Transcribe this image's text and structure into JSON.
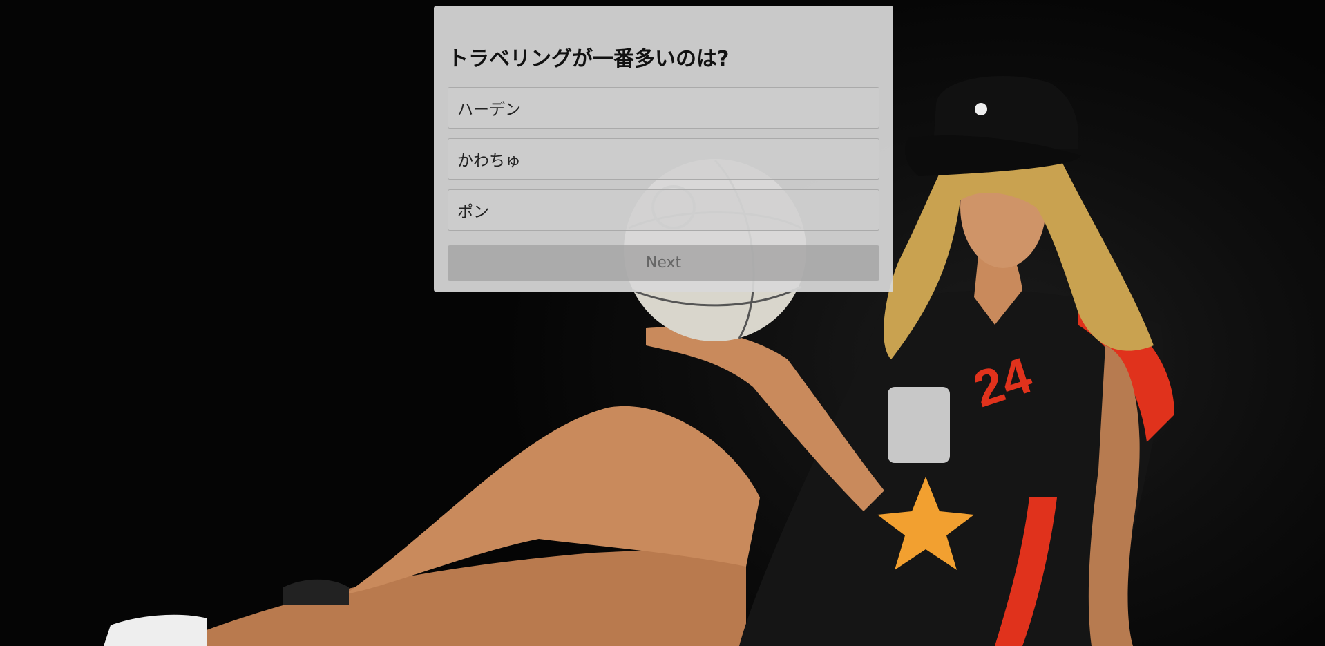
{
  "quiz": {
    "question": "トラベリングが一番多いのは?",
    "options": [
      {
        "label": "ハーデン"
      },
      {
        "label": "かわちゅ"
      },
      {
        "label": "ポン"
      }
    ],
    "next_label": "Next"
  },
  "background": {
    "description_icon": "basketball-player-photo",
    "jersey_number": "24",
    "colors": {
      "backdrop": "#050505",
      "jersey": "#1a1a1a",
      "jersey_accent": "#e0321c",
      "skin": "#c98a5c",
      "hair": "#c9a250",
      "ball": "#d9d6cc"
    }
  }
}
